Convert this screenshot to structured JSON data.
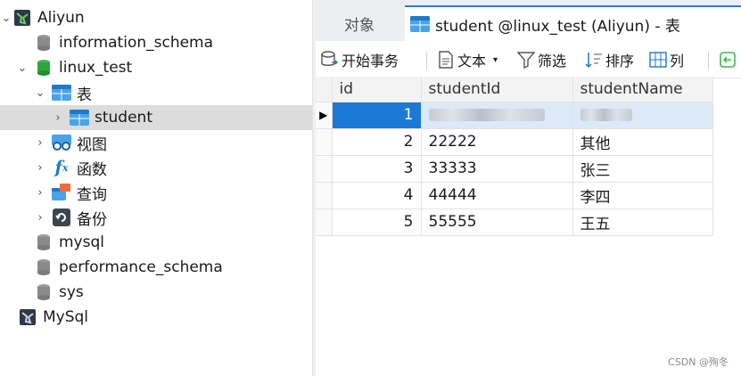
{
  "tree": {
    "connection_label": "Aliyun",
    "information_schema_label": "information_schema",
    "linux_test_label": "linux_test",
    "tables_group_label": "表",
    "student_label": "student",
    "views_label": "视图",
    "functions_label": "函数",
    "queries_label": "查询",
    "backups_label": "备份",
    "mysql_label": "mysql",
    "performance_schema_label": "performance_schema",
    "sys_label": "sys",
    "mysql_connection_label": "MySql"
  },
  "tabs": {
    "objects_label": "对象",
    "active_label": "student @linux_test (Aliyun) - 表"
  },
  "toolbar": {
    "begin_transaction": "开始事务",
    "text": "文本",
    "filter": "筛选",
    "sort": "排序",
    "columns": "列"
  },
  "grid": {
    "columns": [
      "id",
      "studentId",
      "studentName"
    ],
    "rows": [
      {
        "id": "1",
        "studentId": "",
        "studentName": "",
        "redacted": true
      },
      {
        "id": "2",
        "studentId": "22222",
        "studentName": "其他"
      },
      {
        "id": "3",
        "studentId": "33333",
        "studentName": "张三"
      },
      {
        "id": "4",
        "studentId": "44444",
        "studentName": "李四"
      },
      {
        "id": "5",
        "studentId": "55555",
        "studentName": "王五"
      }
    ]
  },
  "watermark": "CSDN @殉冬",
  "colors": {
    "accent": "#1e79d4",
    "selection": "#dcdcdc"
  }
}
